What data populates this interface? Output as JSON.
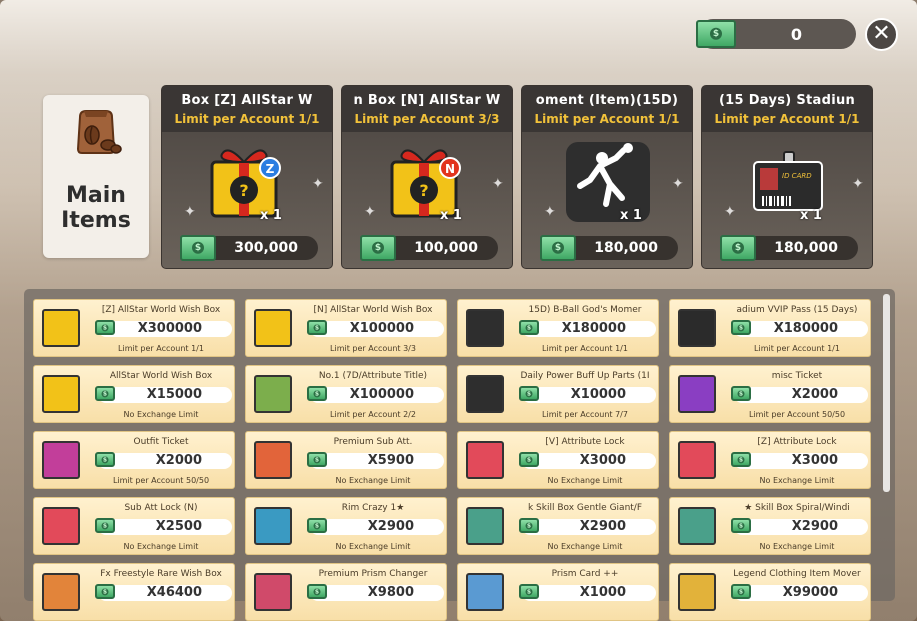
{
  "header": {
    "cash_value": "0",
    "close_label": "✕"
  },
  "category": {
    "label_line1": "Main",
    "label_line2": "Items"
  },
  "featured": [
    {
      "title": "Box    [Z] AllStar W",
      "limit": "Limit per Account 1/1",
      "qty": "x 1",
      "price": "300,000",
      "badge": "Z"
    },
    {
      "title": "n Box    [N] AllStar W",
      "limit": "Limit per Account 3/3",
      "qty": "x 1",
      "price": "100,000",
      "badge": "N"
    },
    {
      "title": "oment (Item)(15D)",
      "limit": "Limit per Account 1/1",
      "qty": "x 1",
      "price": "180,000"
    },
    {
      "title": "(15 Days)    Stadiun",
      "limit": "Limit per Account 1/1",
      "qty": "x 1",
      "price": "180,000",
      "card_text": "ID CARD"
    }
  ],
  "items": [
    {
      "name": "[Z] AllStar World Wish Box",
      "price": "X300000",
      "limit": "Limit per Account 1/1",
      "icon": "gift-box-z-icon"
    },
    {
      "name": "[N] AllStar World Wish Box",
      "price": "X100000",
      "limit": "Limit per Account 3/3",
      "icon": "gift-box-n-icon"
    },
    {
      "name": "15D)       B-Ball God's Momer",
      "price": "X180000",
      "limit": "Limit per Account 1/1",
      "icon": "dunk-silhouette-icon"
    },
    {
      "name": "adium VVIP Pass (15 Days)",
      "price": "X180000",
      "limit": "Limit per Account 1/1",
      "icon": "id-card-icon"
    },
    {
      "name": "AllStar World Wish Box",
      "price": "X15000",
      "limit": "No Exchange Limit",
      "icon": "gift-box-icon"
    },
    {
      "name": "No.1 (7D/Attribute Title)",
      "price": "X100000",
      "limit": "Limit per Account 2/2",
      "icon": "thumbs-up-icon"
    },
    {
      "name": "Daily Power Buff Up Parts (1I",
      "price": "X10000",
      "limit": "Limit per Account 7/7",
      "icon": "muscle-icon"
    },
    {
      "name": "misc Ticket",
      "price": "X2000",
      "limit": "Limit per Account 50/50",
      "icon": "misc-ticket-icon"
    },
    {
      "name": "Outfit Ticket",
      "price": "X2000",
      "limit": "Limit per Account 50/50",
      "icon": "outfit-ticket-icon"
    },
    {
      "name": "Premium Sub Att.",
      "price": "X5900",
      "limit": "No Exchange Limit",
      "icon": "sub-att-card-icon"
    },
    {
      "name": "[V] Attribute Lock",
      "price": "X3000",
      "limit": "No Exchange Limit",
      "icon": "attribute-lock-v-icon"
    },
    {
      "name": "[Z] Attribute Lock",
      "price": "X3000",
      "limit": "No Exchange Limit",
      "icon": "attribute-lock-z-icon"
    },
    {
      "name": "Sub Att Lock (N)",
      "price": "X2500",
      "limit": "No Exchange Limit",
      "icon": "sub-att-lock-icon"
    },
    {
      "name": "Rim Crazy 1★",
      "price": "X2900",
      "limit": "No Exchange Limit",
      "icon": "rim-crazy-icon"
    },
    {
      "name": "k Skill Box      Gentle Giant/F",
      "price": "X2900",
      "limit": "No Exchange Limit",
      "icon": "skill-box-icon"
    },
    {
      "name": "★ Skill Box      Spiral/Windi",
      "price": "X2900",
      "limit": "No Exchange Limit",
      "icon": "skill-box-icon"
    },
    {
      "name": "Fx Freestyle Rare Wish Box",
      "price": "X46400",
      "limit": "",
      "icon": "wish-box-icon"
    },
    {
      "name": "Premium Prism Changer",
      "price": "X9800",
      "limit": "",
      "icon": "prism-changer-icon"
    },
    {
      "name": "Prism Card ++",
      "price": "X1000",
      "limit": "",
      "icon": "prism-card-icon"
    },
    {
      "name": "Legend Clothing Item Mover",
      "price": "X99000",
      "limit": "",
      "icon": "item-mover-icon"
    }
  ]
}
